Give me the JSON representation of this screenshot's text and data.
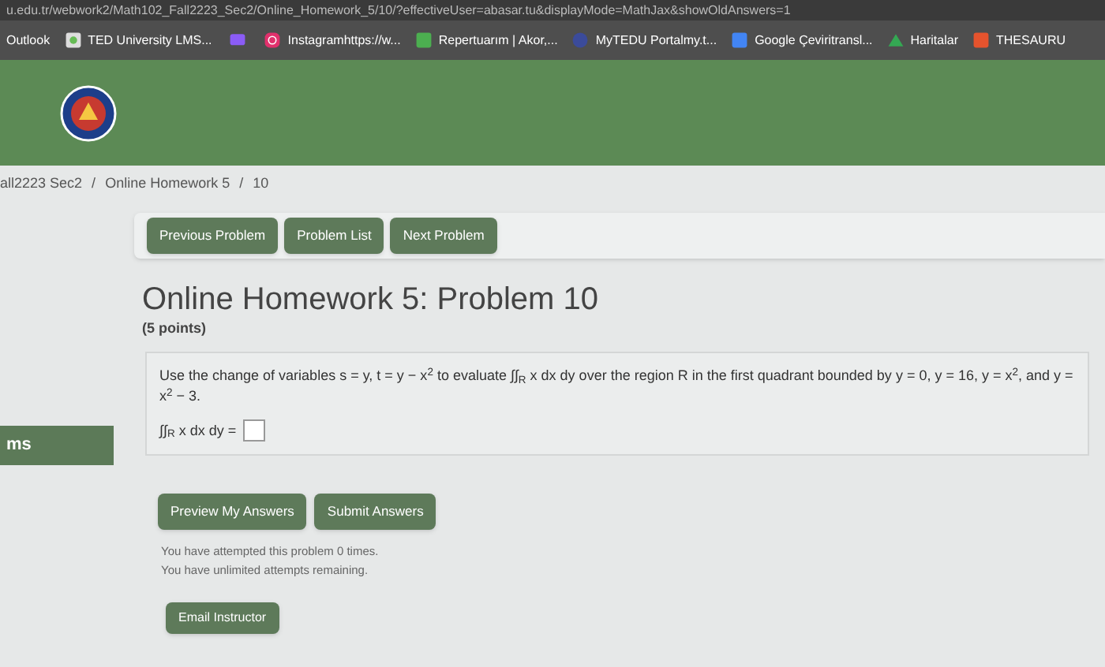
{
  "address_bar": {
    "url": "u.edu.tr/webwork2/Math102_Fall2223_Sec2/Online_Homework_5/10/?effectiveUser=abasar.tu&displayMode=MathJax&showOldAnswers=1"
  },
  "bookmarks": [
    {
      "kind": "labeled",
      "label": "Outlook"
    },
    {
      "kind": "labeled",
      "label": "TED University LMS..."
    },
    {
      "kind": "icon"
    },
    {
      "kind": "labeled",
      "label": "Instagramhttps://w..."
    },
    {
      "kind": "labeled",
      "label": "Repertuarım | Akor,..."
    },
    {
      "kind": "labeled",
      "label": "MyTEDU Portalmy.t..."
    },
    {
      "kind": "labeled",
      "label": "Google Çeviritransl..."
    },
    {
      "kind": "labeled",
      "label": "Haritalar"
    },
    {
      "kind": "labeled",
      "label": "THESAURU"
    }
  ],
  "breadcrumb": [
    {
      "kind": "link",
      "text": "all2223 Sec2"
    },
    {
      "kind": "separator",
      "text": "/"
    },
    {
      "kind": "link",
      "text": "Online Homework 5"
    },
    {
      "kind": "separator",
      "text": "/"
    },
    {
      "kind": "link",
      "text": "10"
    }
  ],
  "sidebar": {
    "item": "ms"
  },
  "nav_buttons": [
    "Previous Problem",
    "Problem List",
    "Next Problem"
  ],
  "title": "Online Homework 5: Problem 10",
  "points": "(5 points)",
  "problem": {
    "statement": "Use the change of variables s = y, t = y − x$^{2}$ to evaluate ∫∫$_{R}$ x dx dy over the region R in the first quadrant bounded by y = 0, y = 16, y = x$^{2}$, and y = x$^{2}$ − 3.",
    "answer_label": "∫∫$_{R}$ x dx dy ="
  },
  "action_buttons": [
    "Preview My Answers",
    "Submit Answers"
  ],
  "messages": [
    "You have attempted this problem 0 times.",
    "You have unlimited attempts remaining."
  ],
  "email_button": "Email Instructor"
}
